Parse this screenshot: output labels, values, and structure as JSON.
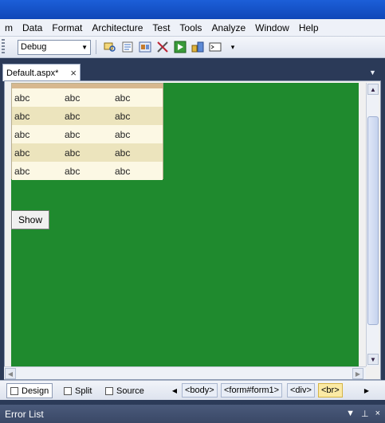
{
  "menu": [
    "m",
    "Data",
    "Format",
    "Architecture",
    "Test",
    "Tools",
    "Analyze",
    "Window",
    "Help"
  ],
  "toolbar": {
    "config_value": "Debug",
    "icons": [
      "find-in-files-icon",
      "properties-icon",
      "object-browser-icon",
      "toolbox-icon",
      "start-page-icon",
      "class-view-icon",
      "immediate-window-icon"
    ]
  },
  "document_tab": {
    "label": "Default.aspx*"
  },
  "gridview": {
    "rows": [
      [
        "abc",
        "abc",
        "abc"
      ],
      [
        "abc",
        "abc",
        "abc"
      ],
      [
        "abc",
        "abc",
        "abc"
      ],
      [
        "abc",
        "abc",
        "abc"
      ],
      [
        "abc",
        "abc",
        "abc"
      ]
    ]
  },
  "show_button": {
    "label": "Show"
  },
  "view_tabs": {
    "design": "Design",
    "split": "Split",
    "source": "Source"
  },
  "breadcrumbs": [
    "<body>",
    "<form#form1>",
    "<div>",
    "<br>"
  ],
  "error_list": {
    "title": "Error List"
  },
  "colors": {
    "design_surface": "#1f8a2e",
    "grid_header": "#d7b88f",
    "grid_odd": "#fcf8e4",
    "grid_even": "#ece4bd"
  }
}
